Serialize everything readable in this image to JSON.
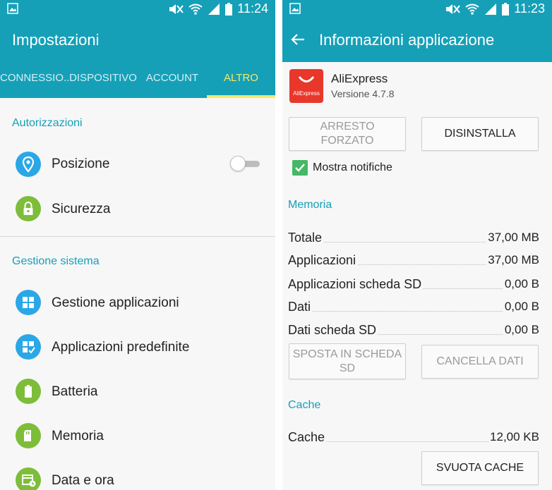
{
  "left": {
    "status": {
      "time": "11:24"
    },
    "appbar": {
      "title": "Impostazioni"
    },
    "tabs": [
      {
        "label": "CONNESSIO.."
      },
      {
        "label": "DISPOSITIVO"
      },
      {
        "label": "ACCOUNT"
      },
      {
        "label": "ALTRO",
        "active": true
      }
    ],
    "sections": {
      "autorizzazioni": "Autorizzazioni",
      "gestione": "Gestione sistema"
    },
    "items": {
      "posizione": "Posizione",
      "sicurezza": "Sicurezza",
      "gestione_app": "Gestione applicazioni",
      "app_predefinite": "Applicazioni predefinite",
      "batteria": "Batteria",
      "memoria": "Memoria",
      "data_ora": "Data e ora"
    },
    "posizione_toggle_on": false
  },
  "right": {
    "status": {
      "time": "11:23"
    },
    "appbar": {
      "title": "Informazioni applicazione"
    },
    "app": {
      "name": "AliExpress",
      "version": "Versione 4.7.8",
      "logo_text": "AliExpress"
    },
    "buttons": {
      "force_stop": "ARRESTO FORZATO",
      "uninstall": "DISINSTALLA",
      "move_sd": "SPOSTA IN SCHEDA SD",
      "clear_data": "CANCELLA DATI",
      "clear_cache": "SVUOTA CACHE"
    },
    "notifications": {
      "label": "Mostra notifiche",
      "checked": true
    },
    "memory": {
      "title": "Memoria",
      "rows": [
        {
          "label": "Totale",
          "value": "37,00 MB"
        },
        {
          "label": "Applicazioni",
          "value": "37,00 MB"
        },
        {
          "label": "Applicazioni scheda SD",
          "value": "0,00 B"
        },
        {
          "label": "Dati",
          "value": "0,00 B"
        },
        {
          "label": "Dati scheda SD",
          "value": "0,00 B"
        }
      ]
    },
    "cache": {
      "title": "Cache",
      "rows": [
        {
          "label": "Cache",
          "value": "12,00 KB"
        }
      ]
    }
  },
  "colors": {
    "primary": "#15a0b8",
    "tab_active": "#f3e96a",
    "icon_blue": "#2aa7e6",
    "icon_green": "#7dbd3a",
    "checkbox": "#45b865",
    "logo_red": "#e8382b"
  },
  "icons": {
    "status_left": "image-icon",
    "status_right": [
      "mute-icon",
      "wifi-icon",
      "signal-icon",
      "battery-icon"
    ],
    "posizione": "location-pin-icon",
    "sicurezza": "lock-icon",
    "gestione_app": "grid-icon",
    "app_predefinite": "grid-check-icon",
    "batteria": "battery-icon",
    "memoria": "sd-card-icon",
    "data_ora": "calendar-clock-icon",
    "back": "arrow-left-icon"
  }
}
